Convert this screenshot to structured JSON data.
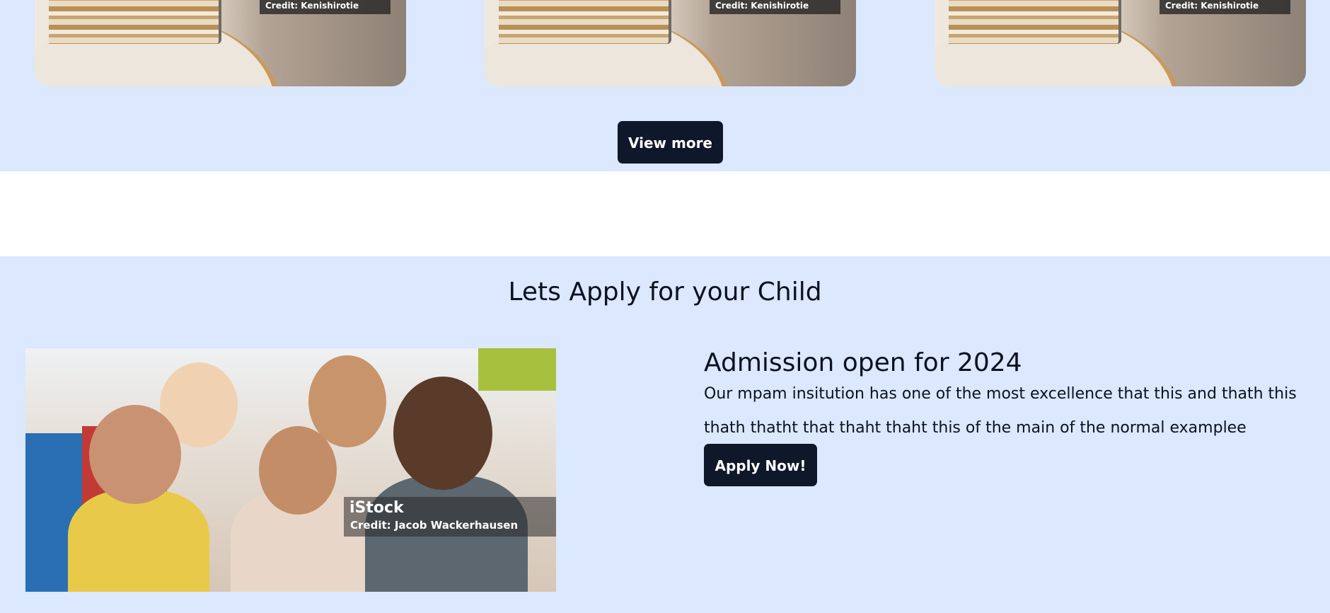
{
  "cards": [
    {
      "credit": "Credit: Kenishirotie"
    },
    {
      "credit": "Credit: Kenishirotie"
    },
    {
      "credit": "Credit: Kenishirotie"
    }
  ],
  "view_more_label": "View more",
  "apply_section": {
    "title": "Lets Apply for your Child",
    "image": {
      "logo": "iStock",
      "credit": "Credit: Jacob Wackerhausen"
    },
    "heading": "Admission open for 2024",
    "body": "Our mpam insitution has one of the most excellence that this and thath this thath thatht that thaht thaht this of the main of the normal examplee",
    "button_label": "Apply Now!"
  },
  "colors": {
    "section_bg": "#dbe8fd",
    "button_bg": "#0f172a",
    "button_text": "#ffffff",
    "text": "#0b1120"
  }
}
